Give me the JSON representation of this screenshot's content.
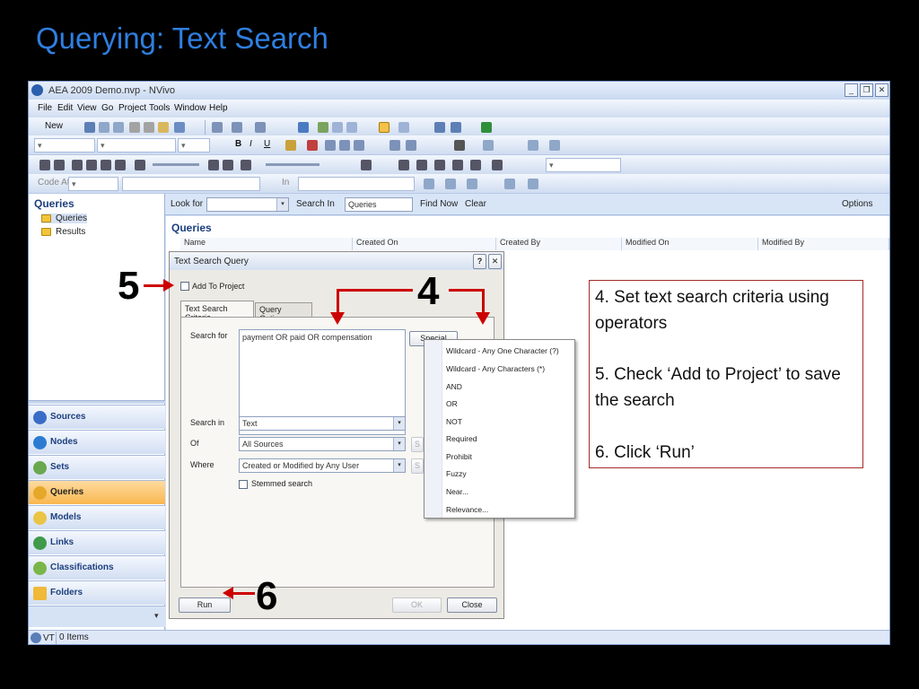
{
  "slide": {
    "title": "Querying: Text Search"
  },
  "window": {
    "title": "AEA 2009 Demo.nvp - NVivo"
  },
  "menu": [
    "File",
    "Edit",
    "View",
    "Go",
    "Project",
    "Tools",
    "Window",
    "Help"
  ],
  "toolbar": {
    "new_label": "New",
    "code_at_label": "Code At",
    "in_label": "In"
  },
  "nav": {
    "heading": "Queries",
    "tree": [
      "Queries",
      "Results"
    ],
    "buttons": [
      "Sources",
      "Nodes",
      "Sets",
      "Queries",
      "Models",
      "Links",
      "Classifications",
      "Folders"
    ]
  },
  "findbar": {
    "look_for": "Look for",
    "search_in": "Search In",
    "search_in_value": "Queries",
    "find_now": "Find Now",
    "clear": "Clear",
    "options": "Options"
  },
  "list": {
    "title": "Queries",
    "columns": [
      "Name",
      "Created On",
      "Created By",
      "Modified On",
      "Modified By"
    ]
  },
  "statusbar": {
    "user": "VT",
    "items": "0 Items"
  },
  "dialog": {
    "title": "Text Search Query",
    "add_to_project": "Add To Project",
    "tabs": [
      "Text Search Criteria",
      "Query Options"
    ],
    "search_for_label": "Search for",
    "search_for_value": "payment OR paid OR compensation",
    "special": "Special",
    "search_in_label": "Search in",
    "search_in_value": "Text",
    "of_label": "Of",
    "of_value": "All Sources",
    "where_label": "Where",
    "where_value": "Created or Modified by Any User",
    "stemmed": "Stemmed search",
    "run": "Run",
    "ok": "OK",
    "close": "Close"
  },
  "special_menu": [
    "Wildcard - Any One Character (?)",
    "Wildcard - Any Characters (*)",
    "AND",
    "OR",
    "NOT",
    "Required",
    "Prohibit",
    "Fuzzy",
    "Near...",
    "Relevance..."
  ],
  "annotations": {
    "n4": "4",
    "n5": "5",
    "n6": "6"
  },
  "notes": [
    "4. Set text search criteria using operators",
    "5. Check ‘Add to Project’ to save the search",
    "6. Click ‘Run’"
  ],
  "colors": {
    "title_blue": "#2f7fe0",
    "arrow_red": "#cc0000",
    "note_border": "#a52a2a"
  }
}
